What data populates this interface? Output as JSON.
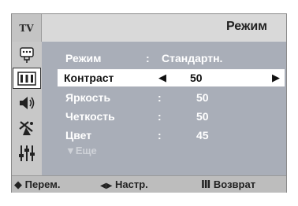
{
  "header": {
    "tab_label": "TV",
    "title": "Режим"
  },
  "sidebar": {
    "icons": [
      "input-icon",
      "picture-icon",
      "sound-icon",
      "channel-antenna-icon",
      "setup-sliders-icon"
    ],
    "active_index": 1
  },
  "menu": {
    "rows": [
      {
        "label": "Режим",
        "colon": ":",
        "value": "Стандартн."
      },
      {
        "label": "Контраст",
        "left_arrow": "◀",
        "value": "50",
        "right_arrow": "▶"
      },
      {
        "label": "Яркость",
        "colon": ":",
        "value": "50"
      },
      {
        "label": "Четкость",
        "colon": ":",
        "value": "50"
      },
      {
        "label": "Цвет",
        "colon": ":",
        "value": "45"
      }
    ],
    "more_label": "▼Еще"
  },
  "footer": {
    "move_icon": "◆",
    "move_label": "Перем.",
    "adjust_icon": "◀▶",
    "adjust_label": "Настр.",
    "return_icon": "Ⅲ",
    "return_label": "Возврат"
  },
  "colors": {
    "frame": "#bdbdbd",
    "content_bg": "#a9aeb8",
    "selected_row": "#ffffff"
  }
}
